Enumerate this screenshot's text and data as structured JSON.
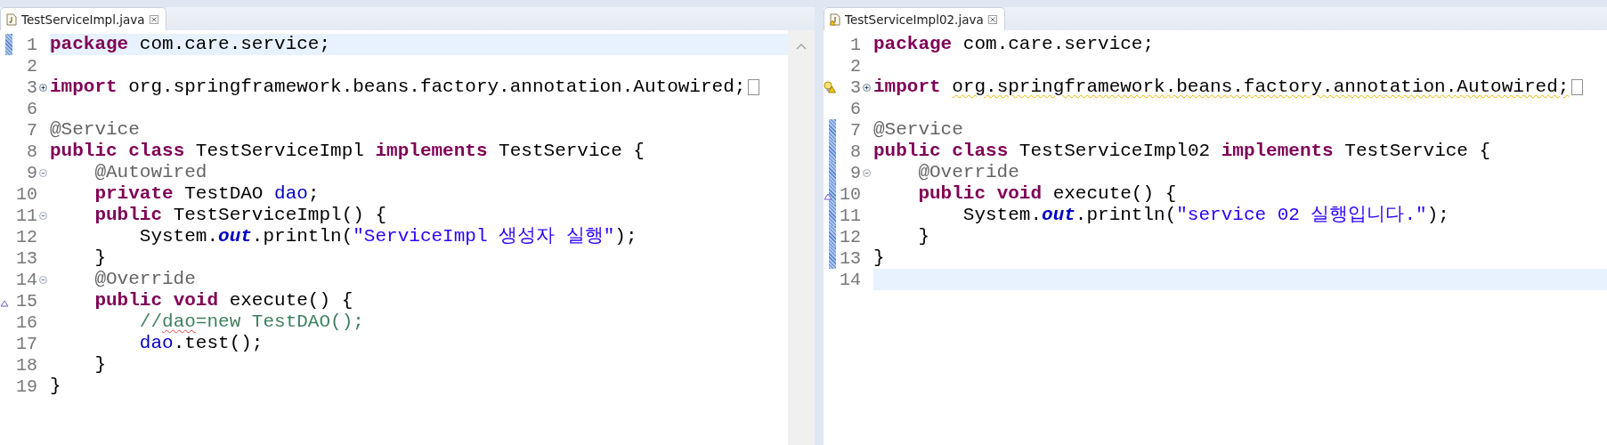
{
  "editors": [
    {
      "tab": {
        "title": "TestServiceImpl.java",
        "warning": false
      },
      "scrollbar": true,
      "lines": [
        {
          "number": "1",
          "changed": true,
          "current": true,
          "tokens": [
            {
              "kind": "keyword",
              "text": "package"
            },
            {
              "kind": "plain",
              "text": " com.care.service;"
            }
          ]
        },
        {
          "number": "2"
        },
        {
          "number": "3",
          "expanded": false,
          "folded": true,
          "tokens": [
            {
              "kind": "keyword",
              "text": "import"
            },
            {
              "kind": "plain",
              "text": " org.springframework.beans.factory.annotation.Autowired;"
            }
          ]
        },
        {
          "number": "6"
        },
        {
          "number": "7",
          "tokens": [
            {
              "kind": "annotation",
              "text": "@Service"
            }
          ]
        },
        {
          "number": "8",
          "tokens": [
            {
              "kind": "keyword",
              "text": "public"
            },
            {
              "kind": "keyword",
              "text": " class"
            },
            {
              "kind": "plain",
              "text": " TestServiceImpl"
            },
            {
              "kind": "keyword",
              "text": " implements"
            },
            {
              "kind": "plain",
              "text": " TestService {"
            }
          ]
        },
        {
          "number": "9",
          "expanded": true,
          "tokens": [
            {
              "kind": "annotation",
              "text": "    @Autowired"
            }
          ]
        },
        {
          "number": "10",
          "tokens": [
            {
              "kind": "keyword",
              "text": "    private"
            },
            {
              "kind": "plain",
              "text": " TestDAO"
            },
            {
              "kind": "field",
              "text": " dao"
            },
            {
              "kind": "plain",
              "text": ";"
            }
          ]
        },
        {
          "number": "11",
          "expanded": true,
          "tokens": [
            {
              "kind": "keyword",
              "text": "    public"
            },
            {
              "kind": "plain",
              "text": " TestServiceImpl() {"
            }
          ]
        },
        {
          "number": "12",
          "tokens": [
            {
              "kind": "plain",
              "text": "        System."
            },
            {
              "kind": "static",
              "text": "out"
            },
            {
              "kind": "plain",
              "text": ".println("
            },
            {
              "kind": "string",
              "text": "\"ServiceImpl 생성자 실행\""
            },
            {
              "kind": "plain",
              "text": ");"
            }
          ]
        },
        {
          "number": "13",
          "tokens": [
            {
              "kind": "plain",
              "text": "    }"
            }
          ]
        },
        {
          "number": "14",
          "expanded": true,
          "tokens": [
            {
              "kind": "annotation",
              "text": "    @Override"
            }
          ]
        },
        {
          "number": "15",
          "overrides": true,
          "tokens": [
            {
              "kind": "keyword",
              "text": "    public"
            },
            {
              "kind": "keyword",
              "text": " void"
            },
            {
              "kind": "plain",
              "text": " execute() {"
            }
          ]
        },
        {
          "number": "16",
          "tokens": [
            {
              "kind": "comment",
              "text": "        //"
            },
            {
              "kind": "comment",
              "text": "dao",
              "misspelled": true
            },
            {
              "kind": "comment",
              "text": "=new TestDAO();"
            }
          ]
        },
        {
          "number": "17",
          "tokens": [
            {
              "kind": "field",
              "text": "        dao"
            },
            {
              "kind": "plain",
              "text": ".test();"
            }
          ]
        },
        {
          "number": "18",
          "tokens": [
            {
              "kind": "plain",
              "text": "    }"
            }
          ]
        },
        {
          "number": "19",
          "tokens": [
            {
              "kind": "plain",
              "text": "}"
            }
          ]
        }
      ]
    },
    {
      "tab": {
        "title": "TestServiceImpl02.java",
        "warning": true
      },
      "lines": [
        {
          "number": "1",
          "tokens": [
            {
              "kind": "keyword",
              "text": "package"
            },
            {
              "kind": "plain",
              "text": " com.care.service;"
            }
          ]
        },
        {
          "number": "2"
        },
        {
          "number": "3",
          "expanded": false,
          "warning": true,
          "folded": true,
          "tokens": [
            {
              "kind": "keyword",
              "text": "import "
            },
            {
              "kind": "plain",
              "text": "org.springframework.beans.factory.annotation.Autowired;",
              "warning": true
            }
          ]
        },
        {
          "number": "6"
        },
        {
          "number": "7",
          "changed": true,
          "tokens": [
            {
              "kind": "annotation",
              "text": "@Service"
            }
          ]
        },
        {
          "number": "8",
          "changed": true,
          "tokens": [
            {
              "kind": "keyword",
              "text": "public"
            },
            {
              "kind": "keyword",
              "text": " class"
            },
            {
              "kind": "plain",
              "text": " TestServiceImpl02"
            },
            {
              "kind": "keyword",
              "text": " implements"
            },
            {
              "kind": "plain",
              "text": " TestService {"
            }
          ]
        },
        {
          "number": "9",
          "expanded": true,
          "changed": true,
          "tokens": [
            {
              "kind": "annotation",
              "text": "    @Override"
            }
          ]
        },
        {
          "number": "10",
          "changed": true,
          "overrides": true,
          "tokens": [
            {
              "kind": "keyword",
              "text": "    public"
            },
            {
              "kind": "keyword",
              "text": " void"
            },
            {
              "kind": "plain",
              "text": " execute() {"
            }
          ]
        },
        {
          "number": "11",
          "changed": true,
          "tokens": [
            {
              "kind": "plain",
              "text": "        System."
            },
            {
              "kind": "static",
              "text": "out"
            },
            {
              "kind": "plain",
              "text": ".println("
            },
            {
              "kind": "string",
              "text": "\"service 02 실행입니다.\""
            },
            {
              "kind": "plain",
              "text": ");"
            }
          ]
        },
        {
          "number": "12",
          "changed": true,
          "tokens": [
            {
              "kind": "plain",
              "text": "    }"
            }
          ]
        },
        {
          "number": "13",
          "changed": true,
          "tokens": [
            {
              "kind": "plain",
              "text": "}"
            }
          ]
        },
        {
          "number": "14",
          "current": true
        }
      ]
    }
  ]
}
